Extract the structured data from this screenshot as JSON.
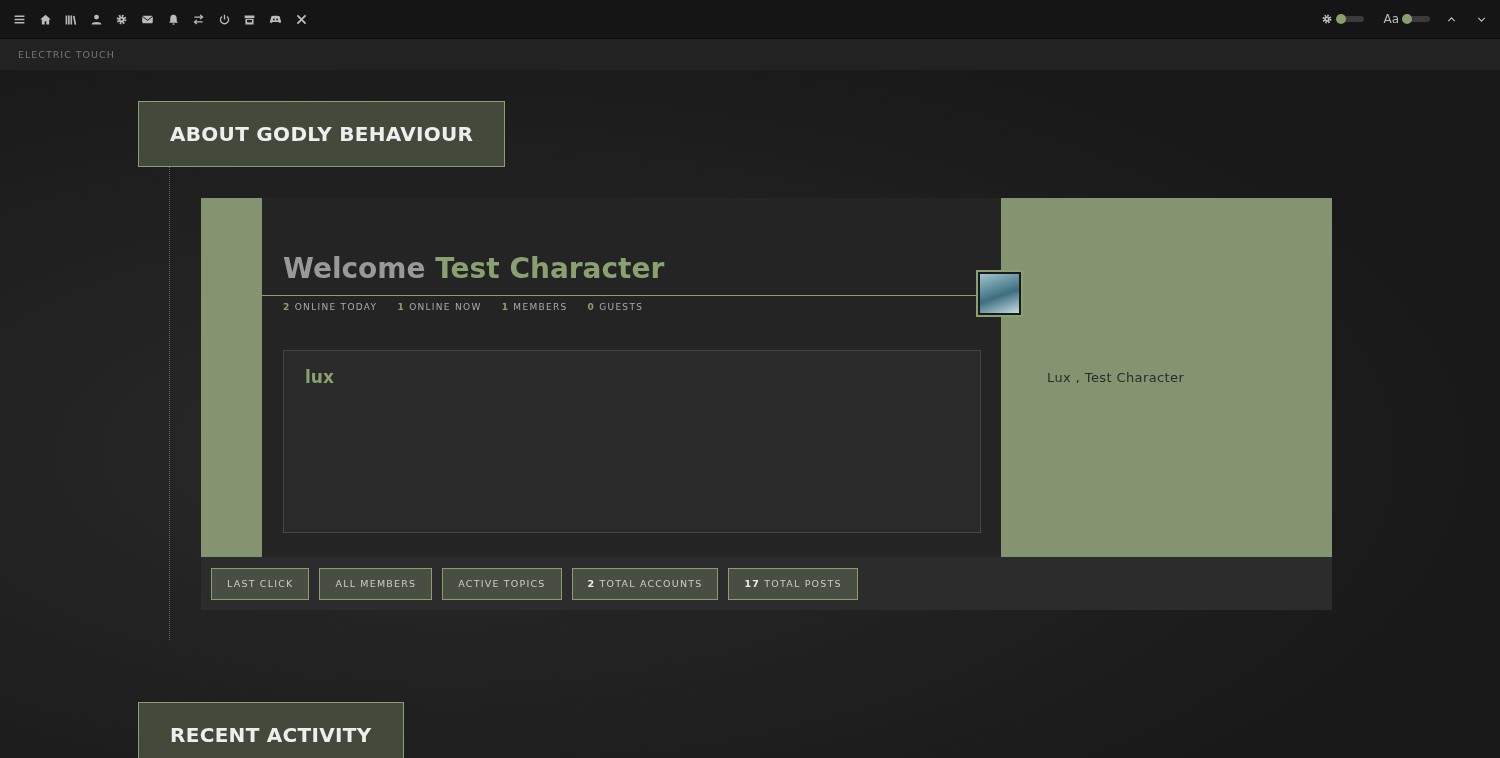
{
  "topbar": {
    "toggles": [
      {
        "on": false
      },
      {
        "label": "Aa",
        "on": false
      }
    ]
  },
  "subbar": {
    "title": "ELECTRIC TOUCH"
  },
  "section": {
    "title": "ABOUT GODLY BEHAVIOUR"
  },
  "welcome": {
    "greeting": "Welcome",
    "name": "Test Character",
    "stats": [
      {
        "count": "2",
        "label": "ONLINE TODAY"
      },
      {
        "count": "1",
        "label": "ONLINE NOW"
      },
      {
        "count": "1",
        "label": "MEMBERS"
      },
      {
        "count": "0",
        "label": "GUESTS"
      }
    ],
    "panel_title": "lux",
    "online_list": "Lux , Test Character",
    "buttons": [
      {
        "label": "LAST CLICK"
      },
      {
        "label": "ALL MEMBERS"
      },
      {
        "label": "ACTIVE TOPICS"
      },
      {
        "count": "2",
        "label": "TOTAL ACCOUNTS"
      },
      {
        "count": "17",
        "label": "TOTAL POSTS"
      }
    ]
  },
  "section2": {
    "title": "RECENT ACTIVITY"
  }
}
